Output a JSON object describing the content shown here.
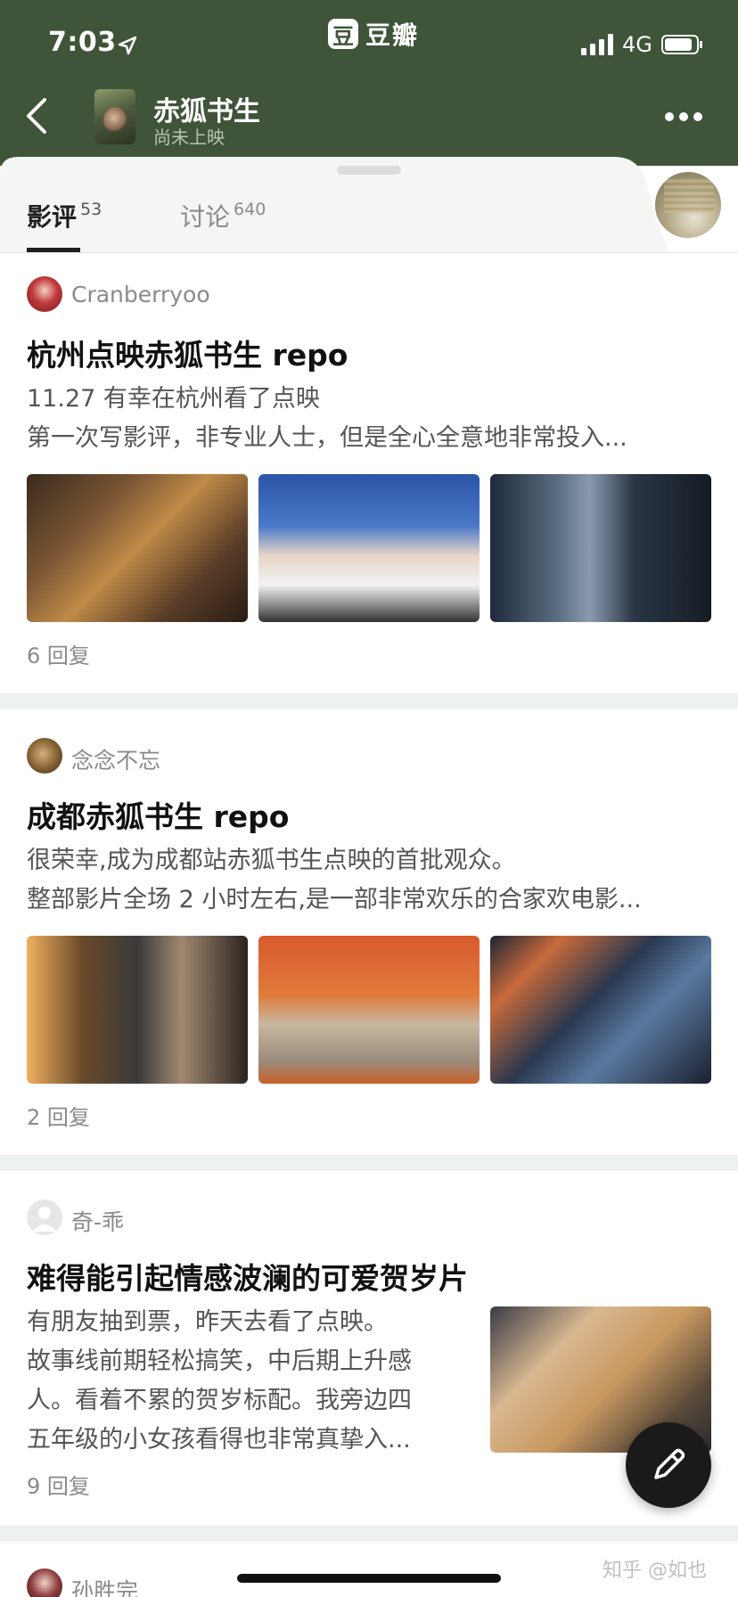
{
  "status_bar": {
    "time": "7:03",
    "network": "4G"
  },
  "app": {
    "brand_mark": "豆",
    "brand_name": "豆瓣"
  },
  "header": {
    "title": "赤狐书生",
    "subtitle": "尚未上映"
  },
  "tabs": [
    {
      "label": "影评",
      "count": "53",
      "active": true
    },
    {
      "label": "讨论",
      "count": "640",
      "active": false
    }
  ],
  "reviews": [
    {
      "author": "Cranberryoo",
      "title": "杭州点映赤狐书生 repo",
      "lines": [
        "11.27 有幸在杭州看了点映",
        "第一次写影评，非专业人士，但是全心全意地非常投入..."
      ],
      "replies": "6 回复"
    },
    {
      "author": "念念不忘",
      "title": "成都赤狐书生 repo",
      "lines": [
        "很荣幸,成为成都站赤狐书生点映的首批观众。",
        "整部影片全场 2 小时左右,是一部非常欢乐的合家欢电影..."
      ],
      "replies": "2 回复"
    },
    {
      "author": "奇-乖",
      "title": "难得能引起情感波澜的可爱贺岁片",
      "lines": [
        "有朋友抽到票，昨天去看了点映。",
        "故事线前期轻松搞笑，中后期上升感",
        "人。看着不累的贺岁标配。我旁边四",
        "五年级的小女孩看得也非常真挚入..."
      ],
      "replies": "9 回复"
    },
    {
      "author": "孙胜完"
    }
  ],
  "watermark": "知乎 @如也",
  "colors": {
    "header_bg": "#3f5439",
    "separator": "#eef2ee"
  }
}
